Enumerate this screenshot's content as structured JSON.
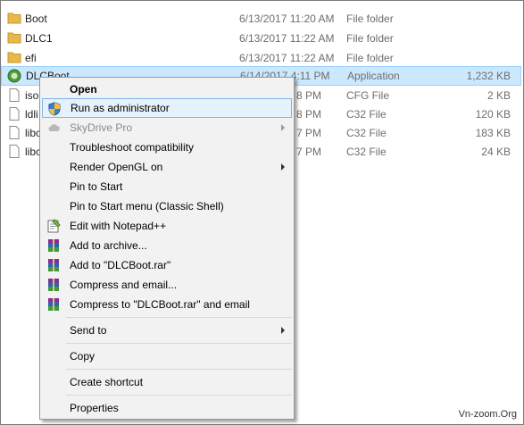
{
  "files": [
    {
      "icon": "folder-icon",
      "name": "Boot",
      "date": "6/13/2017 11:20 AM",
      "type": "File folder",
      "size": ""
    },
    {
      "icon": "folder-icon",
      "name": "DLC1",
      "date": "6/13/2017 11:22 AM",
      "type": "File folder",
      "size": ""
    },
    {
      "icon": "folder-icon",
      "name": "efi",
      "date": "6/13/2017 11:22 AM",
      "type": "File folder",
      "size": ""
    },
    {
      "icon": "application-icon",
      "name": "DLCBoot",
      "date": "6/14/2017 4:11 PM",
      "type": "Application",
      "size": "1,232 KB"
    },
    {
      "icon": "file-icon",
      "name": "iso",
      "date": "8 PM",
      "type": "CFG File",
      "size": "2 KB"
    },
    {
      "icon": "file-icon",
      "name": "ldli",
      "date": "8 PM",
      "type": "C32 File",
      "size": "120 KB"
    },
    {
      "icon": "file-icon",
      "name": "libc",
      "date": "7 PM",
      "type": "C32 File",
      "size": "183 KB"
    },
    {
      "icon": "file-icon",
      "name": "libc",
      "date": "7 PM",
      "type": "C32 File",
      "size": "24 KB"
    }
  ],
  "context_menu": {
    "items": [
      {
        "label": "Open"
      },
      {
        "label": "Run as administrator",
        "icon": "shield-icon"
      },
      {
        "label": "SkyDrive Pro",
        "icon": "cloud-icon"
      },
      {
        "label": "Troubleshoot compatibility"
      },
      {
        "label": "Render OpenGL on"
      },
      {
        "label": "Pin to Start"
      },
      {
        "label": "Pin to Start menu (Classic Shell)"
      },
      {
        "label": "Edit with Notepad++",
        "icon": "notepadpp-icon"
      },
      {
        "label": "Add to archive...",
        "icon": "winrar-icon"
      },
      {
        "label": "Add to \"DLCBoot.rar\"",
        "icon": "winrar-icon"
      },
      {
        "label": "Compress and email...",
        "icon": "winrar-icon"
      },
      {
        "label": "Compress to \"DLCBoot.rar\" and email",
        "icon": "winrar-icon"
      },
      {
        "label": "Send to"
      },
      {
        "label": "Copy"
      },
      {
        "label": "Create shortcut"
      },
      {
        "label": "Properties"
      }
    ]
  },
  "watermark": "Vn-zoom.Org",
  "colors": {
    "selection_bg": "#cce8ff",
    "menu_bg": "#f2f2f2",
    "menu_highlight": "#e5f1fb",
    "folder": "#e8b84a"
  }
}
